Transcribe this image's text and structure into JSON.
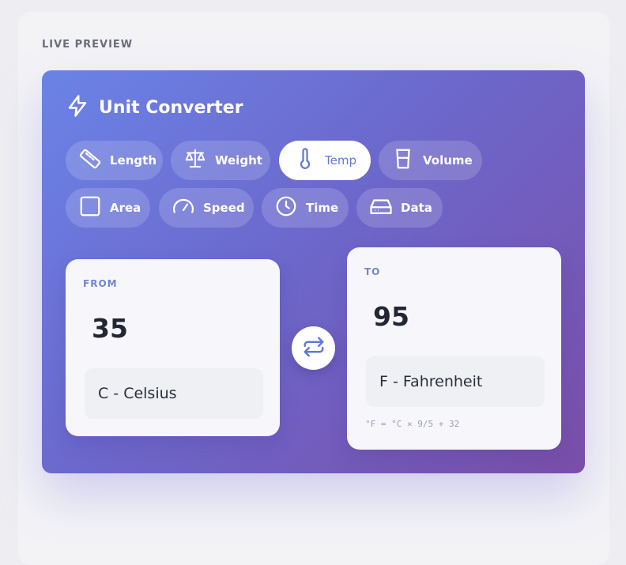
{
  "preview_label": "LIVE PREVIEW",
  "app": {
    "title": "Unit Converter",
    "icon": "lightning-icon"
  },
  "categories": [
    {
      "label": "Length",
      "icon": "ruler-icon"
    },
    {
      "label": "Weight",
      "icon": "scale-icon"
    },
    {
      "label": "Temp",
      "icon": "thermometer-icon",
      "active": true
    },
    {
      "label": "Volume",
      "icon": "beaker-icon"
    },
    {
      "label": "Area",
      "icon": "square-icon"
    },
    {
      "label": "Speed",
      "icon": "speedometer-icon"
    },
    {
      "label": "Time",
      "icon": "clock-icon"
    },
    {
      "label": "Data",
      "icon": "hard-drive-icon"
    }
  ],
  "from": {
    "label": "FROM",
    "value": "35",
    "unit": "C - Celsius"
  },
  "to": {
    "label": "TO",
    "value": "95",
    "unit": "F - Fahrenheit",
    "formula": "°F = °C × 9/5 + 32"
  },
  "colors": {
    "accent": "#6f86d6",
    "gradient_start": "#6b83e6",
    "gradient_end": "#7a4ea8"
  }
}
